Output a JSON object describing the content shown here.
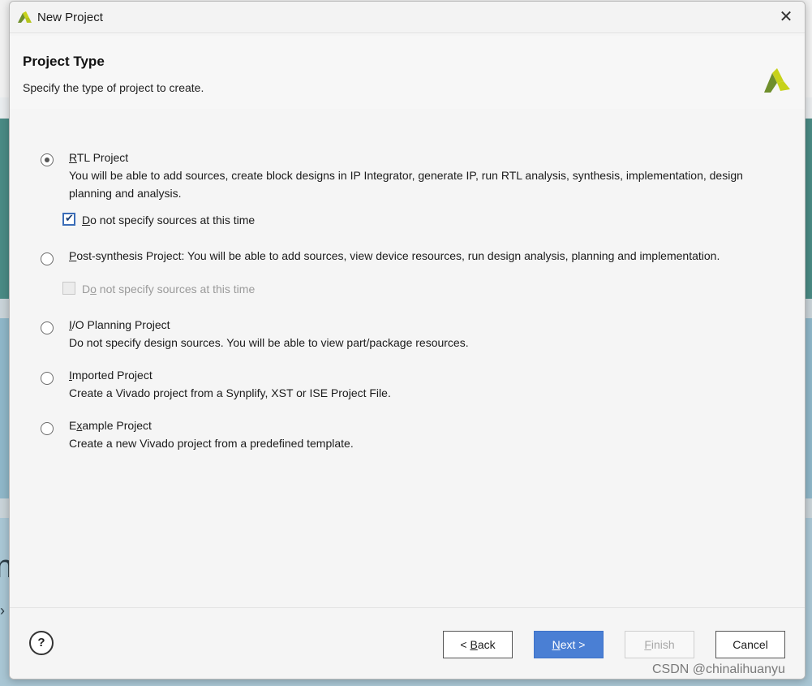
{
  "window": {
    "title": "New Project",
    "close_glyph": "✕"
  },
  "header": {
    "title": "Project Type",
    "subtitle": "Specify the type of project to create."
  },
  "options": [
    {
      "label_prefix": "",
      "label_mnemonic": "R",
      "label_rest": "TL Project",
      "description": "You will be able to add sources, create block designs in IP Integrator, generate IP, run RTL analysis, synthesis, implementation, design planning and analysis.",
      "selected": true,
      "checkbox": {
        "mnemonic": "D",
        "rest": "o not specify sources at this time",
        "checked": true,
        "enabled": true
      }
    },
    {
      "label_prefix": "",
      "label_mnemonic": "P",
      "label_rest": "ost-synthesis Project: You will be able to add sources, view device resources, run design analysis, planning and implementation.",
      "description": "",
      "selected": false,
      "checkbox": {
        "prefix": "D",
        "mnemonic": "o",
        "rest": " not specify sources at this time",
        "checked": false,
        "enabled": false
      }
    },
    {
      "label_prefix": "",
      "label_mnemonic": "I",
      "label_rest": "/O Planning Project",
      "description": "Do not specify design sources. You will be able to view part/package resources.",
      "selected": false
    },
    {
      "label_prefix": "",
      "label_mnemonic": "I",
      "label_rest": "mported Project",
      "description": "Create a Vivado project from a Synplify, XST or ISE Project File.",
      "selected": false
    },
    {
      "label_prefix": "E",
      "label_mnemonic": "x",
      "label_rest": "ample Project",
      "description": "Create a new Vivado project from a predefined template.",
      "selected": false
    }
  ],
  "footer": {
    "help_label": "?",
    "back": {
      "prefix": "< ",
      "mnemonic": "B",
      "rest": "ack"
    },
    "next": {
      "mnemonic": "N",
      "rest": "ext >"
    },
    "finish": {
      "mnemonic": "F",
      "rest": "inish"
    },
    "cancel": "Cancel"
  },
  "watermark": "CSDN @chinalihuanyu",
  "colors": {
    "primary_button": "#4a7fd4",
    "checkbox_border": "#3b6db8",
    "logo_yellow": "#c7d21a",
    "logo_green": "#6f8f2c"
  }
}
